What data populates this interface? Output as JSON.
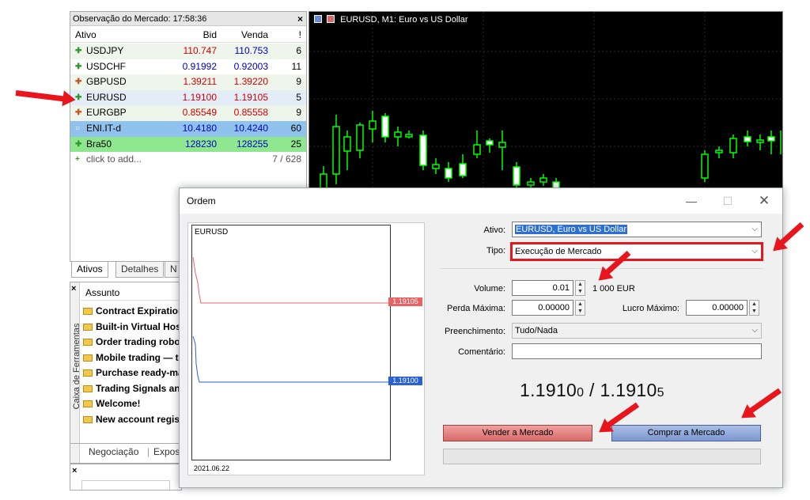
{
  "market_watch": {
    "title": "Observação do Mercado: 17:58:36",
    "close": "×",
    "columns": {
      "symbol": "Ativo",
      "bid": "Bid",
      "ask": "Venda",
      "spread": "!"
    },
    "rows": [
      {
        "symbol": "USDJPY",
        "bid": "110.747",
        "ask": "110.753",
        "spread": "6",
        "dir": "up"
      },
      {
        "symbol": "USDCHF",
        "bid": "0.91992",
        "ask": "0.92003",
        "spread": "11",
        "dir": "up"
      },
      {
        "symbol": "GBPUSD",
        "bid": "1.39211",
        "ask": "1.39220",
        "spread": "9",
        "dir": "down"
      },
      {
        "symbol": "EURUSD",
        "bid": "1.19100",
        "ask": "1.19105",
        "spread": "5",
        "dir": "up"
      },
      {
        "symbol": "EURGBP",
        "bid": "0.85549",
        "ask": "0.85558",
        "spread": "9",
        "dir": "down"
      },
      {
        "symbol": "ENI.IT-d",
        "bid": "10.4180",
        "ask": "10.4240",
        "spread": "60",
        "dir": "neutral"
      },
      {
        "symbol": "Bra50",
        "bid": "128230",
        "ask": "128255",
        "spread": "25",
        "dir": "up"
      }
    ],
    "add_label": "click to add...",
    "count": "7 / 628",
    "tabs": [
      "Ativos",
      "Detalhes",
      "N"
    ]
  },
  "chart": {
    "title": "EURUSD, M1:  Euro vs US Dollar"
  },
  "toolbox": {
    "side_label": "Caixa de Ferramentas",
    "close": "×",
    "header": "Assunto",
    "news": [
      "Contract Expiration",
      "Built-in Virtual Host",
      "Order trading robot",
      "Mobile trading — t",
      "Purchase ready-ma",
      "Trading Signals and",
      "Welcome!",
      "New account regist"
    ],
    "tabs": [
      "Negociação",
      "Exposi"
    ],
    "bottom_close": "×"
  },
  "order_dialog": {
    "title": "Ordem",
    "tick_chart": {
      "symbol": "EURUSD",
      "date": "2021.06.22",
      "ask_label": "1.19105",
      "bid_label": "1.19100"
    },
    "symbol_label": "Ativo:",
    "symbol_value": "EURUSD, Euro vs US Dollar",
    "type_label": "Tipo:",
    "type_value": "Execução de Mercado",
    "volume_label": "Volume:",
    "volume_value": "0.01",
    "volume_unit": "1 000 EUR",
    "sl_label": "Perda Máxima:",
    "sl_value": "0.00000",
    "tp_label": "Lucro Máximo:",
    "tp_value": "0.00000",
    "filling_label": "Preenchimento:",
    "filling_value": "Tudo/Nada",
    "comment_label": "Comentário:",
    "comment_value": "",
    "price_bid_main": "1.1910",
    "price_bid_small": "0",
    "price_sep": " / ",
    "price_ask_main": "1.1910",
    "price_ask_small": "5",
    "sell_label": "Vender a Mercado",
    "buy_label": "Comprar a Mercado",
    "colors": {
      "sell": "#d96a6a",
      "buy": "#7d97cf",
      "ask_line": "#e86464",
      "bid_line": "#2a62d6",
      "highlight": "#e8161c"
    }
  }
}
